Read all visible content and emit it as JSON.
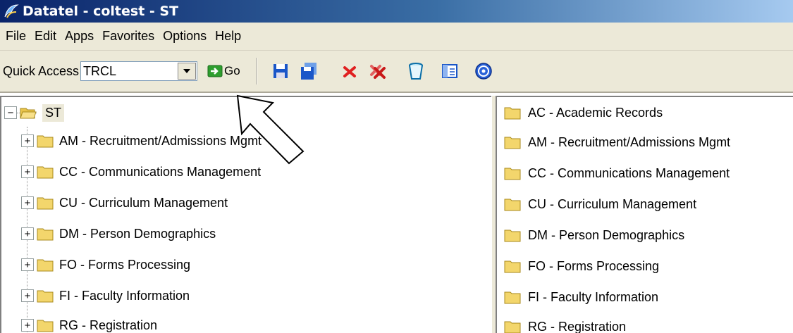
{
  "window": {
    "title": "Datatel - coltest - ST"
  },
  "menubar": {
    "items": [
      "File",
      "Edit",
      "Apps",
      "Favorites",
      "Options",
      "Help"
    ]
  },
  "toolbar": {
    "quick_access_label": "Quick Access",
    "quick_access_value": "TRCL",
    "go_label": "Go",
    "icons": [
      "save-icon",
      "save-all-icon",
      "cancel-icon",
      "cancel-all-icon",
      "trash-icon",
      "window-icon",
      "help-icon"
    ],
    "accent_colors": {
      "save": "#1a56c8",
      "cancel": "#e02020",
      "go": "#2e9e2e"
    }
  },
  "tree": {
    "root": "ST",
    "children": [
      "AM - Recruitment/Admissions Mgmt",
      "CC - Communications Management",
      "CU - Curriculum Management",
      "DM - Person Demographics",
      "FO - Forms Processing",
      "FI - Faculty Information",
      "RG - Registration"
    ]
  },
  "list": {
    "items": [
      "AC - Academic Records",
      "AM - Recruitment/Admissions Mgmt",
      "CC - Communications Management",
      "CU - Curriculum Management",
      "DM - Person Demographics",
      "FO - Forms Processing",
      "FI - Faculty Information",
      "RG - Registration"
    ]
  }
}
